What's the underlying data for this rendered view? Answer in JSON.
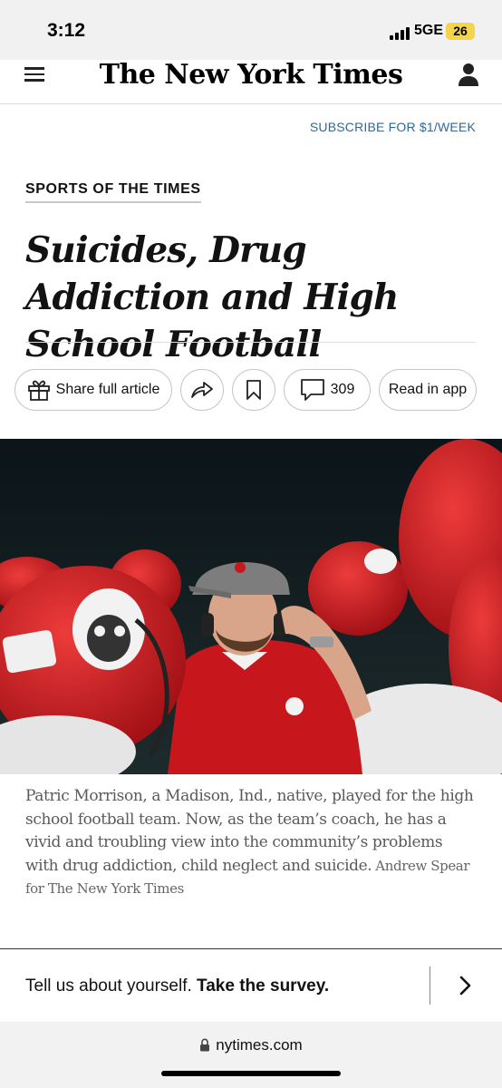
{
  "status_bar": {
    "time": "3:12",
    "network": "5GE",
    "battery": "26"
  },
  "nav": {
    "masthead": "The New York Times"
  },
  "subscribe": {
    "label": "SUBSCRIBE FOR $1/WEEK"
  },
  "article": {
    "kicker": "SPORTS OF THE TIMES",
    "headline": "Suicides, Drug Addiction and High School Football",
    "actions": {
      "share_label": "Share full article",
      "comment_count": "309",
      "read_in_app_label": "Read in app"
    },
    "caption": "Patric Morrison, a Madison, Ind., native, played for the high school football team. Now, as the team’s coach, he has a vivid and troubling view into the community’s problems with drug addiction, child neglect and suicide.",
    "credit": "Andrew Spear for The New York Times"
  },
  "survey": {
    "text": "Tell us about yourself.",
    "cta": "Take the survey."
  },
  "browser": {
    "url": "nytimes.com"
  },
  "colors": {
    "link_blue": "#326891",
    "battery_yellow": "#f4d44b",
    "helmet_red": "#c8161d"
  }
}
